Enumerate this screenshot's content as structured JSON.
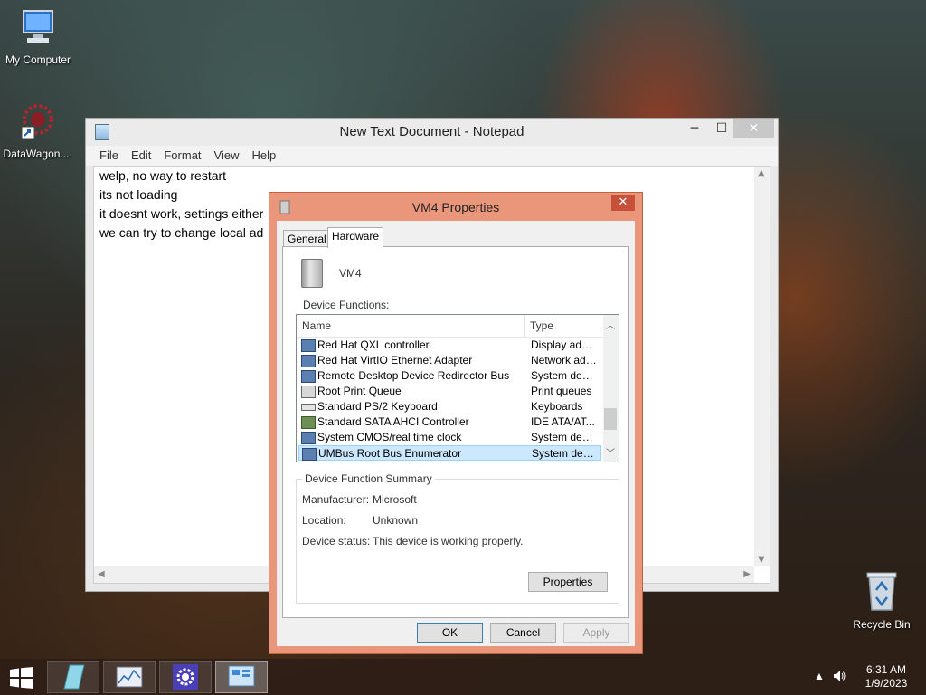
{
  "desktop": {
    "icons": [
      {
        "label": "My Computer"
      },
      {
        "label": "DataWagon..."
      },
      {
        "label": "Recycle Bin"
      }
    ]
  },
  "notepad": {
    "title": "New Text Document - Notepad",
    "menu": [
      "File",
      "Edit",
      "Format",
      "View",
      "Help"
    ],
    "lines": [
      "welp, no way to restart",
      "its not loading",
      "it doesnt work, settings either",
      "we can try to change local ad"
    ]
  },
  "dialog": {
    "title": "VM4 Properties",
    "tabs": [
      "General",
      "Hardware"
    ],
    "active_tab": "Hardware",
    "device_name": "VM4",
    "device_functions_label": "Device Functions:",
    "columns": {
      "name": "Name",
      "type": "Type"
    },
    "devices": [
      {
        "name": "Red Hat QXL controller",
        "type": "Display adap..."
      },
      {
        "name": "Red Hat VirtIO Ethernet Adapter",
        "type": "Network ada..."
      },
      {
        "name": "Remote Desktop Device Redirector Bus",
        "type": "System devi..."
      },
      {
        "name": "Root Print Queue",
        "type": "Print queues"
      },
      {
        "name": "Standard PS/2 Keyboard",
        "type": "Keyboards"
      },
      {
        "name": "Standard SATA AHCI Controller",
        "type": "IDE ATA/AT..."
      },
      {
        "name": "System CMOS/real time clock",
        "type": "System devi..."
      },
      {
        "name": "UMBus Root Bus Enumerator",
        "type": "System devi..."
      }
    ],
    "selected_index": 7,
    "summary": {
      "legend": "Device Function Summary",
      "manufacturer_label": "Manufacturer:",
      "manufacturer": "Microsoft",
      "location_label": "Location:",
      "location": "Unknown",
      "status_label": "Device status:",
      "status": "This device is working properly."
    },
    "buttons": {
      "properties": "Properties",
      "ok": "OK",
      "cancel": "Cancel",
      "apply": "Apply"
    }
  },
  "taskbar": {
    "time": "6:31 AM",
    "date": "1/9/2023"
  }
}
